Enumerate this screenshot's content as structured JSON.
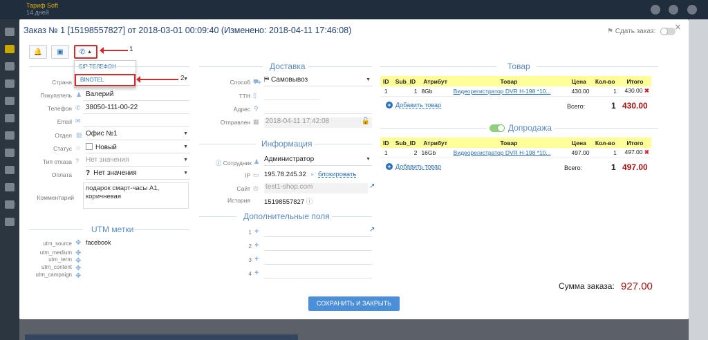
{
  "topbar": {
    "brand_title": "Тариф Soft",
    "brand_sub": "14 дней"
  },
  "modal": {
    "title": "Заказ № 1 [15198557827] от 2018-03-01 00:09:40 (Изменено: 2018-04-11 17:46:08)",
    "close": "×",
    "sdat_label": "Сдать заказ:"
  },
  "toolbar": {
    "caret": "▲"
  },
  "phone_menu": {
    "items": [
      "SIP ТЕЛЕФОН",
      "BINOTEL"
    ]
  },
  "annotations": {
    "n1": "1",
    "n2": "2"
  },
  "customer": {
    "country_label": "Страна",
    "buyer_label": "Покупатель",
    "buyer": "Валерий",
    "phone_label": "Телефон",
    "phone": "38050-111-00-22",
    "email_label": "Email",
    "dept_label": "Отдел",
    "dept": "Офис №1",
    "status_label": "Статус",
    "status": "Новый",
    "refusal_label": "Тип отказа",
    "refusal": "Нет значения",
    "payment_label": "Оплата",
    "payment": "Нет значения",
    "comment_label": "Комментарий",
    "comment": "подарок смарт-часы А1, коричневая"
  },
  "utm": {
    "title": "UTM метки",
    "source_label": "utm_source",
    "source": "facebook",
    "medium_label": "utm_medium",
    "term_label": "utm_term",
    "content_label": "utm_content",
    "campaign_label": "utm_campaign"
  },
  "delivery": {
    "title": "Доставка",
    "method_label": "Способ",
    "method": "Самовывоз",
    "ttn_label": "ТТН",
    "address_label": "Адрес",
    "sent_label": "Отправлен",
    "sent": "2018-04-11 17:42:08"
  },
  "info": {
    "title": "Информация",
    "employee_label": "Сотрудник",
    "employee": "Администратор",
    "ip_label": "IP",
    "ip": "195.78.245.32",
    "block": "блокировать",
    "site_label": "Сайт",
    "site": "test1-shop.com",
    "history_label": "История",
    "history": "15198557827"
  },
  "extra": {
    "title": "Дополнительные поля",
    "fields": [
      "1",
      "2",
      "3",
      "4"
    ]
  },
  "goods": {
    "title": "Товар",
    "headers": [
      "ID",
      "Sub_ID",
      "Атрибут",
      "Товар",
      "Цена",
      "Кол-во",
      "Итого"
    ],
    "row": [
      "1",
      "1",
      "8Gb",
      "Видеорегистратор DVR H-198 *10...",
      "430.00",
      "1",
      "430.00"
    ],
    "add": "Добавить товар",
    "total_label": "Всего:",
    "total_qty": "1",
    "total": "430.00"
  },
  "upsell": {
    "title": "Допродажа",
    "headers": [
      "ID",
      "Sub_ID",
      "Атрибут",
      "Товар",
      "Цена",
      "Кол-во",
      "Итого"
    ],
    "row": [
      "1",
      "2",
      "16Gb",
      "Видеорегистратор DVR H-198 *10...",
      "497.00",
      "1",
      "497.00"
    ],
    "add": "Добавить товар",
    "total_label": "Всего:",
    "total_qty": "1",
    "total": "497.00"
  },
  "summary": {
    "label": "Сумма заказа:",
    "value": "927.00"
  },
  "save_button": "СОХРАНИТЬ И ЗАКРЫТЬ",
  "colors": {
    "accent": "#4a8fd8",
    "highlight": "#d12b2b",
    "total_red": "#a31515",
    "table_header": "#ffff99"
  }
}
